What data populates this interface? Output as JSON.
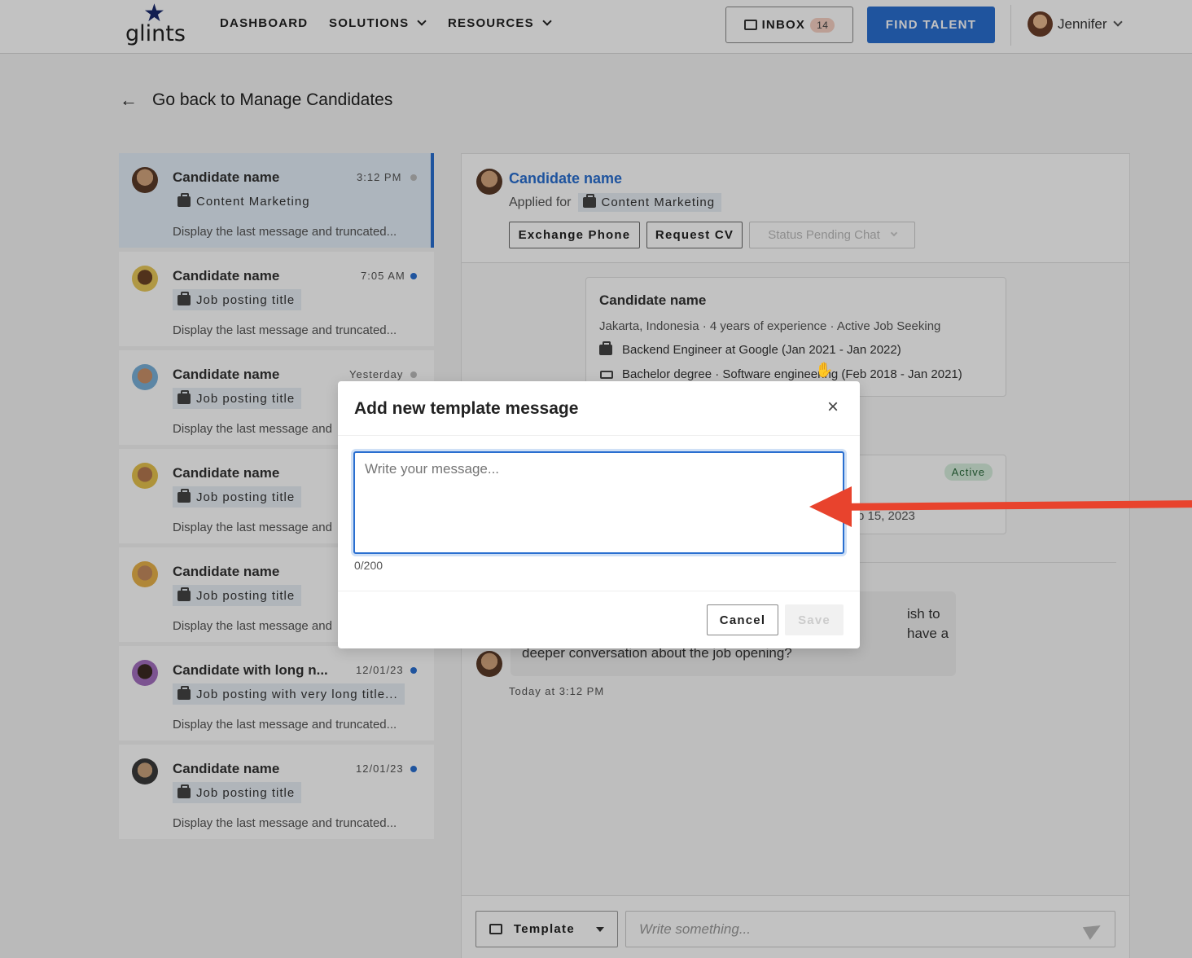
{
  "header": {
    "logo_text": "glints",
    "nav": [
      "DASHBOARD",
      "SOLUTIONS",
      "RESOURCES"
    ],
    "inbox_label": "INBOX",
    "inbox_count": "14",
    "find_talent_label": "FIND TALENT",
    "user_name": "Jennifer"
  },
  "back_link": "Go back to Manage Candidates",
  "conversations": [
    {
      "name": "Candidate name",
      "time": "3:12 PM",
      "tag": "Content Marketing",
      "message": "Display the last message and truncated...",
      "unread": false
    },
    {
      "name": "Candidate name",
      "time": "7:05 AM",
      "tag": "Job posting title",
      "message": "Display the last message and truncated...",
      "unread": true
    },
    {
      "name": "Candidate name",
      "time": "Yesterday",
      "tag": "Job posting title",
      "message": "Display the last message and",
      "unread": false
    },
    {
      "name": "Candidate name",
      "time": "",
      "tag": "Job posting title",
      "message": "Display the last message and",
      "unread": false
    },
    {
      "name": "Candidate name",
      "time": "",
      "tag": "Job posting title",
      "message": "Display the last message and",
      "unread": false
    },
    {
      "name": "Candidate with long n...",
      "time": "12/01/23",
      "tag": "Job posting with very long title...",
      "message": "Display the last message and truncated...",
      "unread": true
    },
    {
      "name": "Candidate name",
      "time": "12/01/23",
      "tag": "Job posting title",
      "message": "Display the last message and truncated...",
      "unread": true
    }
  ],
  "chat_header": {
    "name": "Candidate name",
    "applied_for_label": "Applied for",
    "job": "Content Marketing",
    "exchange_phone": "Exchange Phone",
    "request_cv": "Request CV",
    "status": "Status Pending Chat"
  },
  "profile_card": {
    "name": "Candidate name",
    "meta": "Jakarta, Indonesia ·  4 years of experience ·  Active Job Seeking",
    "work": "Backend Engineer at Google (Jan 2021 - Jan 2022)",
    "education": "Bachelor degree · Software engineering (Feb 2018 - Jan 2021)"
  },
  "job_card": {
    "badge": "Active",
    "date_fragment": "b 15, 2023"
  },
  "message": {
    "fragment_1": "ish to",
    "fragment_2": "have a",
    "text_line": "deeper conversation about the job opening?",
    "time": "Today at 3:12 PM"
  },
  "composer": {
    "template_label": "Template",
    "placeholder": "Write something..."
  },
  "modal": {
    "title": "Add new template message",
    "placeholder": "Write your message...",
    "counter": "0/200",
    "cancel_label": "Cancel",
    "save_label": "Save"
  },
  "colors": {
    "brand_blue": "#2a6fd0",
    "annotation_red": "#e8432d",
    "unread_dot": "#2a6fd0",
    "read_dot": "#bbbbbb"
  }
}
